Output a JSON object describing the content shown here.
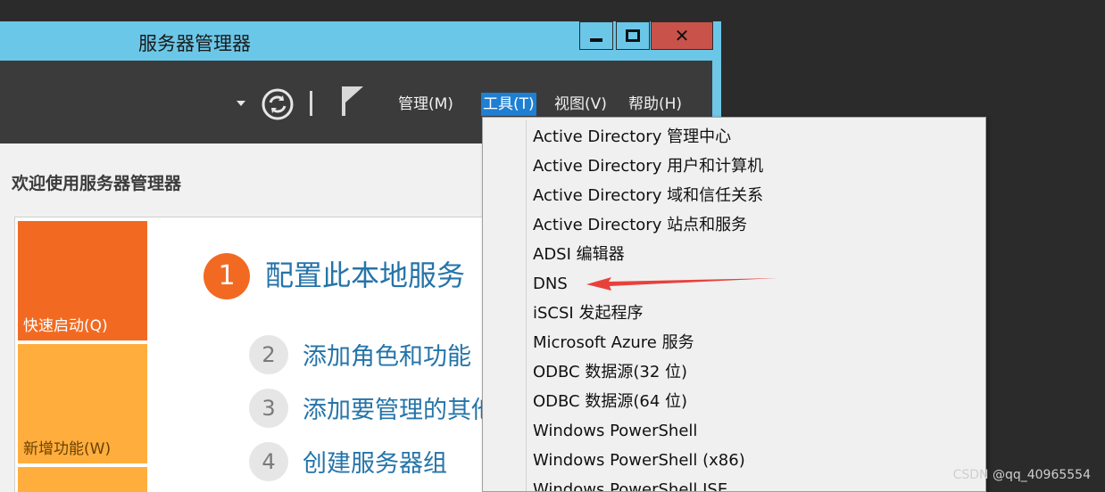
{
  "window": {
    "title": "服务器管理器"
  },
  "menu": {
    "manage": "管理(M)",
    "tools": "工具(T)",
    "view": "视图(V)",
    "help": "帮助(H)"
  },
  "content": {
    "welcome": "欢迎使用服务器管理器",
    "tiles": {
      "quick_start": "快速启动(Q)",
      "whats_new": "新增功能(W)"
    },
    "steps": [
      {
        "number": "1",
        "label": "配置此本地服务"
      },
      {
        "number": "2",
        "label": "添加角色和功能"
      },
      {
        "number": "3",
        "label": "添加要管理的其他"
      },
      {
        "number": "4",
        "label": "创建服务器组"
      }
    ]
  },
  "tools_menu": {
    "items": [
      "Active Directory 管理中心",
      "Active Directory 用户和计算机",
      "Active Directory 域和信任关系",
      "Active Directory 站点和服务",
      "ADSI 编辑器",
      "DNS",
      "iSCSI 发起程序",
      "Microsoft Azure 服务",
      "ODBC 数据源(32 位)",
      "ODBC 数据源(64 位)",
      "Windows PowerShell",
      "Windows PowerShell (x86)",
      "Windows PowerShell ISE"
    ],
    "highlighted_item": "DNS"
  },
  "colors": {
    "titlebar": "#6bc7e8",
    "toolbar": "#3b3b3b",
    "accent_orange": "#f26a22",
    "tile_amber": "#ffae3d",
    "link_blue": "#2574a9",
    "annotation_arrow": "#e8413c"
  },
  "icons": [
    "minimize-icon",
    "maximize-icon",
    "close-icon",
    "refresh-icon",
    "flag-icon",
    "dropdown-caret-icon"
  ],
  "watermark": "CSDN @qq_40965554"
}
